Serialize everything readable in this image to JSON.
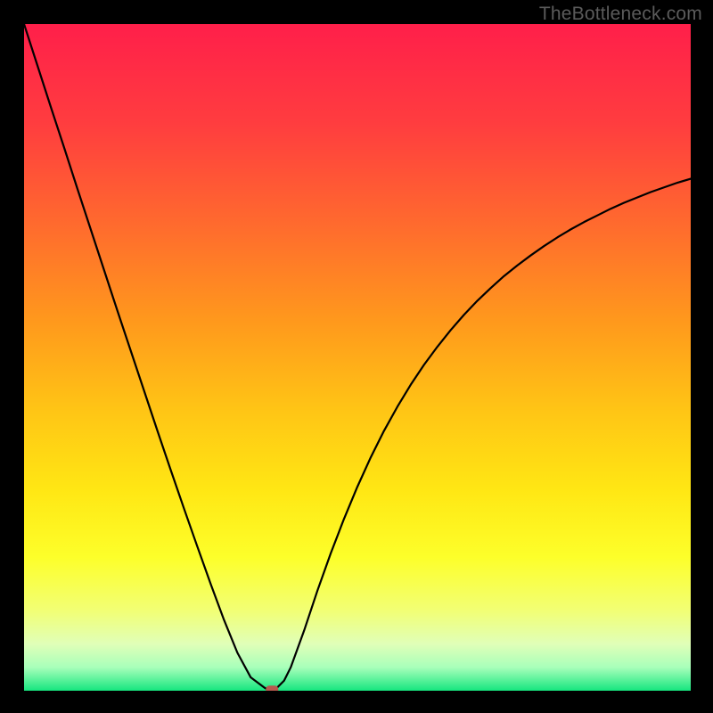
{
  "attribution": "TheBottleneck.com",
  "colors": {
    "frame": "#000000",
    "curve": "#000000",
    "marker": "#b75a4e",
    "gradient_stops": [
      {
        "offset": 0.0,
        "color": "#ff1f4a"
      },
      {
        "offset": 0.15,
        "color": "#ff3d3f"
      },
      {
        "offset": 0.3,
        "color": "#ff6a2e"
      },
      {
        "offset": 0.45,
        "color": "#ff9a1c"
      },
      {
        "offset": 0.58,
        "color": "#ffc515"
      },
      {
        "offset": 0.7,
        "color": "#ffe714"
      },
      {
        "offset": 0.8,
        "color": "#fdff2a"
      },
      {
        "offset": 0.88,
        "color": "#f2ff75"
      },
      {
        "offset": 0.93,
        "color": "#e0ffb8"
      },
      {
        "offset": 0.965,
        "color": "#a8ffba"
      },
      {
        "offset": 1.0,
        "color": "#16e67f"
      }
    ]
  },
  "chart_data": {
    "type": "line",
    "title": "",
    "xlabel": "",
    "ylabel": "",
    "ylim": [
      0,
      100
    ],
    "x": [
      0.0,
      0.02,
      0.04,
      0.06,
      0.08,
      0.1,
      0.12,
      0.14,
      0.16,
      0.18,
      0.2,
      0.22,
      0.24,
      0.26,
      0.28,
      0.3,
      0.32,
      0.34,
      0.36,
      0.365,
      0.37,
      0.375,
      0.38,
      0.39,
      0.4,
      0.42,
      0.44,
      0.46,
      0.48,
      0.5,
      0.52,
      0.54,
      0.56,
      0.58,
      0.6,
      0.62,
      0.64,
      0.66,
      0.68,
      0.7,
      0.72,
      0.74,
      0.76,
      0.78,
      0.8,
      0.82,
      0.84,
      0.86,
      0.88,
      0.9,
      0.92,
      0.94,
      0.96,
      0.98,
      1.0
    ],
    "series": [
      {
        "name": "bottleneck-curve",
        "values": [
          100.0,
          93.8,
          87.6,
          81.5,
          75.3,
          69.2,
          63.1,
          57.0,
          51.0,
          45.0,
          39.0,
          33.1,
          27.3,
          21.6,
          16.0,
          10.6,
          5.7,
          2.0,
          0.5,
          0.2,
          0.1,
          0.2,
          0.5,
          1.5,
          3.5,
          9.0,
          15.0,
          20.6,
          25.8,
          30.6,
          35.0,
          39.0,
          42.6,
          45.9,
          48.9,
          51.6,
          54.1,
          56.4,
          58.5,
          60.4,
          62.2,
          63.8,
          65.3,
          66.7,
          68.0,
          69.2,
          70.3,
          71.3,
          72.3,
          73.2,
          74.0,
          74.8,
          75.5,
          76.2,
          76.8
        ]
      }
    ],
    "optimal_point": {
      "x": 0.372,
      "y": 0.1
    }
  }
}
